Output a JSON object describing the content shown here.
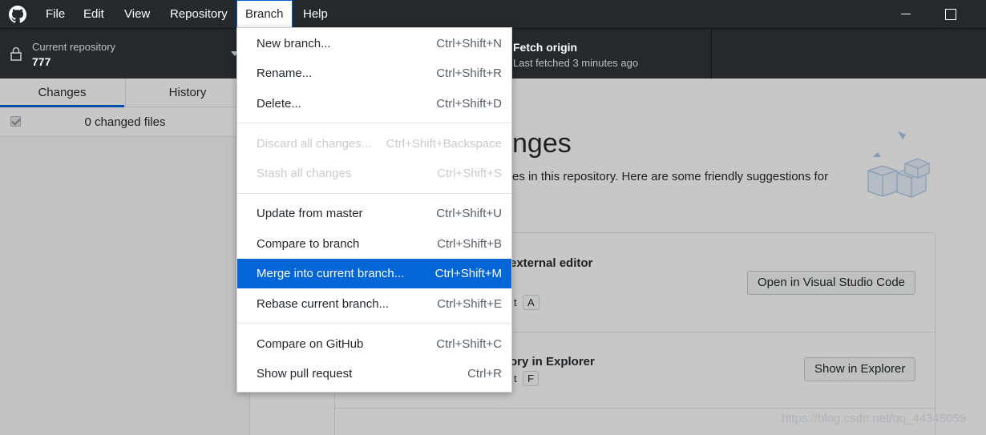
{
  "menubar": {
    "items": [
      "File",
      "Edit",
      "View",
      "Repository",
      "Branch",
      "Help"
    ],
    "open_menu": "Branch"
  },
  "toolbar": {
    "repo_sub": "Current repository",
    "repo_name": "777",
    "fetch_title": "Fetch origin",
    "fetch_sub": "Last fetched 3 minutes ago"
  },
  "sidebar": {
    "tabs": [
      "Changes",
      "History"
    ],
    "selected_tab": "Changes",
    "changed_files": "0 changed files"
  },
  "main": {
    "heading_visible": "nges",
    "intro_visible": "es in this repository. Here are some friendly suggestions for",
    "suggestions": [
      {
        "title_visible": "external editor",
        "shortcut_frag": "t",
        "shortcut_key": "A",
        "button": "Open in Visual Studio Code"
      },
      {
        "title_visible": "ory in Explorer",
        "shortcut_frag": "t",
        "shortcut_key": "F",
        "button": "Show in Explorer"
      }
    ]
  },
  "branch_menu": {
    "groups": [
      [
        {
          "label": "New branch...",
          "accel": "Ctrl+Shift+N",
          "enabled": true
        },
        {
          "label": "Rename...",
          "accel": "Ctrl+Shift+R",
          "enabled": true
        },
        {
          "label": "Delete...",
          "accel": "Ctrl+Shift+D",
          "enabled": true
        }
      ],
      [
        {
          "label": "Discard all changes...",
          "accel": "Ctrl+Shift+Backspace",
          "enabled": false
        },
        {
          "label": "Stash all changes",
          "accel": "Ctrl+Shift+S",
          "enabled": false
        }
      ],
      [
        {
          "label": "Update from master",
          "accel": "Ctrl+Shift+U",
          "enabled": true
        },
        {
          "label": "Compare to branch",
          "accel": "Ctrl+Shift+B",
          "enabled": true
        },
        {
          "label": "Merge into current branch...",
          "accel": "Ctrl+Shift+M",
          "enabled": true,
          "highlighted": true
        },
        {
          "label": "Rebase current branch...",
          "accel": "Ctrl+Shift+E",
          "enabled": true
        }
      ],
      [
        {
          "label": "Compare on GitHub",
          "accel": "Ctrl+Shift+C",
          "enabled": true
        },
        {
          "label": "Show pull request",
          "accel": "Ctrl+R",
          "enabled": true
        }
      ]
    ]
  },
  "watermark": "https://blog.csdn.net/qq_44345059",
  "colors": {
    "titlebar": "#24292e",
    "accent": "#0366d6",
    "highlight_text": "#ffffff"
  }
}
